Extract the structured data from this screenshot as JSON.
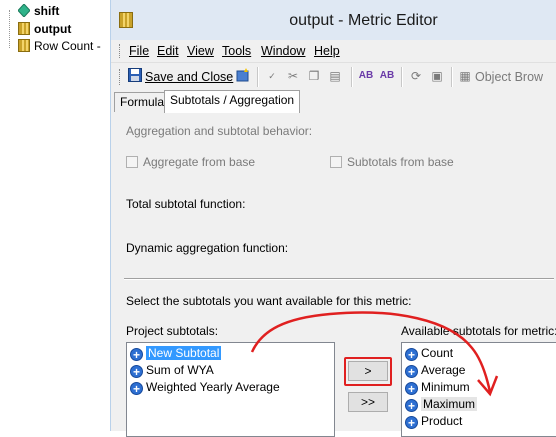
{
  "tree": {
    "items": [
      {
        "label": "shift",
        "icon": "diamond-icon",
        "bold": true
      },
      {
        "label": "output",
        "icon": "metric-icon",
        "bold": true
      },
      {
        "label": "Row Count -",
        "icon": "metric-icon",
        "bold": false
      }
    ]
  },
  "window": {
    "title": "output - Metric Editor"
  },
  "menu": {
    "file": "File",
    "edit": "Edit",
    "view": "View",
    "tools": "Tools",
    "window": "Window",
    "help": "Help"
  },
  "toolbar": {
    "save_close": "Save and Close",
    "object_browser": "Object Brow"
  },
  "tabs": {
    "formula": "Formula",
    "subtotals": "Subtotals / Aggregation"
  },
  "panel": {
    "heading": "Aggregation and subtotal behavior:",
    "aggregate_from_base": "Aggregate from base",
    "subtotals_from_base": "Subtotals from base",
    "total_subtotal_function": "Total subtotal function:",
    "dynamic_aggregation_function": "Dynamic aggregation function:",
    "select_prompt": "Select the subtotals you want available for this metric:",
    "project_subtotals_label": "Project subtotals:",
    "available_subtotals_label": "Available subtotals for metric:",
    "project_subtotals": [
      "New Subtotal",
      "Sum of WYA",
      "Weighted Yearly Average"
    ],
    "available_subtotals": [
      "Count",
      "Average",
      "Minimum",
      "Maximum",
      "Product"
    ],
    "add_button": ">",
    "add_all_button": ">>"
  },
  "colors": {
    "annotation_red": "#e02020",
    "selection_blue": "#3399ff"
  }
}
